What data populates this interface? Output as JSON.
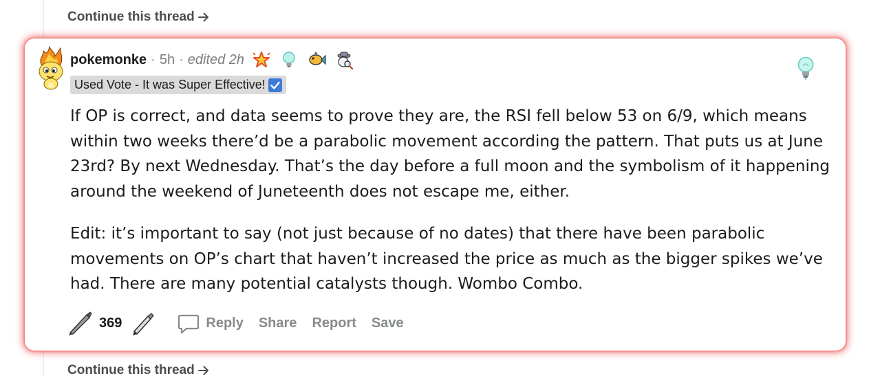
{
  "thread": {
    "continue_label": "Continue this thread"
  },
  "comment": {
    "username": "pokemonke",
    "separator": "·",
    "time": "5h",
    "edited": "edited 2h",
    "flair_text": "Used Vote - It was Super Effective!",
    "awards": [
      "star-award",
      "lightbulb-award",
      "fish-award",
      "detective-award"
    ],
    "paragraphs": [
      "If OP is correct, and data seems to prove they are, the RSI fell below 53 on 6/9, which means within two weeks there’d be a parabolic movement according the pattern. That puts us at June 23rd? By next Wednesday. That’s the day before a full moon and the symbolism of it happening around the weekend of Juneteenth does not escape me, either.",
      "Edit: it’s important to say (not just because of no dates) that there have been parabolic movements on OP’s chart that haven’t increased the price as much as the bigger spikes we’ve had. There are many potential catalysts though. Wombo Combo."
    ],
    "score": "369",
    "actions": {
      "reply": "Reply",
      "share": "Share",
      "report": "Report",
      "save": "Save"
    }
  },
  "colors": {
    "highlight_glow": "#eb3c3c",
    "flair_bg": "#dadada",
    "action_text": "#878a8c",
    "check_blue": "#3d7cd6"
  }
}
